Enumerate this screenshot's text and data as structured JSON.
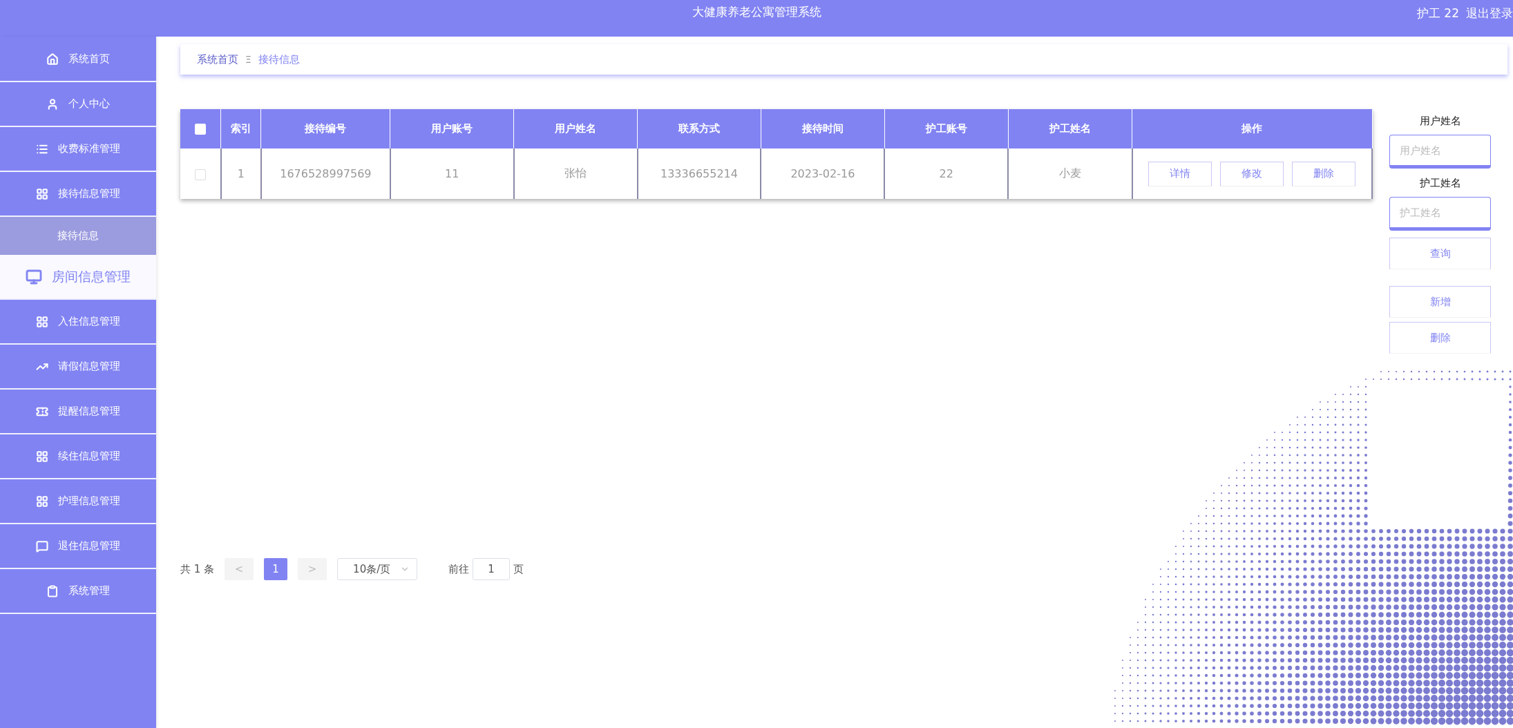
{
  "header": {
    "title": "大健康养老公寓管理系统",
    "user": "护工 22",
    "logout": "退出登录"
  },
  "sidebar": {
    "items": [
      {
        "label": "系统首页",
        "hovered": false
      },
      {
        "label": "个人中心",
        "hovered": false
      },
      {
        "label": "收费标准管理",
        "hovered": false
      },
      {
        "label": "接待信息管理",
        "hovered": false,
        "expanded": true,
        "children": [
          {
            "label": "接待信息",
            "selected": true
          }
        ]
      },
      {
        "label": "房间信息管理",
        "hovered": true
      },
      {
        "label": "入住信息管理",
        "hovered": false
      },
      {
        "label": "请假信息管理",
        "hovered": false
      },
      {
        "label": "提醒信息管理",
        "hovered": false
      },
      {
        "label": "续住信息管理",
        "hovered": false
      },
      {
        "label": "护理信息管理",
        "hovered": false
      },
      {
        "label": "退住信息管理",
        "hovered": false
      },
      {
        "label": "系统管理",
        "hovered": false
      }
    ]
  },
  "breadcrumb": {
    "items": [
      "系统首页",
      "接待信息"
    ],
    "separator": "Ξ"
  },
  "table": {
    "select_all_checked": false,
    "columns": [
      "索引",
      "接待编号",
      "用户账号",
      "用户姓名",
      "联系方式",
      "接待时间",
      "护工账号",
      "护工姓名",
      "操作"
    ],
    "rows": [
      {
        "checked": false,
        "cells": [
          "1",
          "1676528997569",
          "11",
          "张怡",
          "13336655214",
          "2023-02-16",
          "22",
          "小麦"
        ],
        "actions": [
          "详情",
          "修改",
          "删除"
        ]
      }
    ]
  },
  "search": {
    "fields": [
      {
        "label": "用户姓名",
        "placeholder": "用户姓名"
      },
      {
        "label": "护工姓名",
        "placeholder": "护工姓名"
      }
    ],
    "query_button": "查询",
    "buttons": [
      "新增",
      "删除"
    ]
  },
  "pagination": {
    "total": "共 1 条",
    "prev": "<",
    "pages": [
      {
        "label": "1",
        "selected": true
      }
    ],
    "next": ">",
    "page_size": "10条/页",
    "goto_label": "前往",
    "goto_value": "1",
    "goto_suffix": "页"
  }
}
